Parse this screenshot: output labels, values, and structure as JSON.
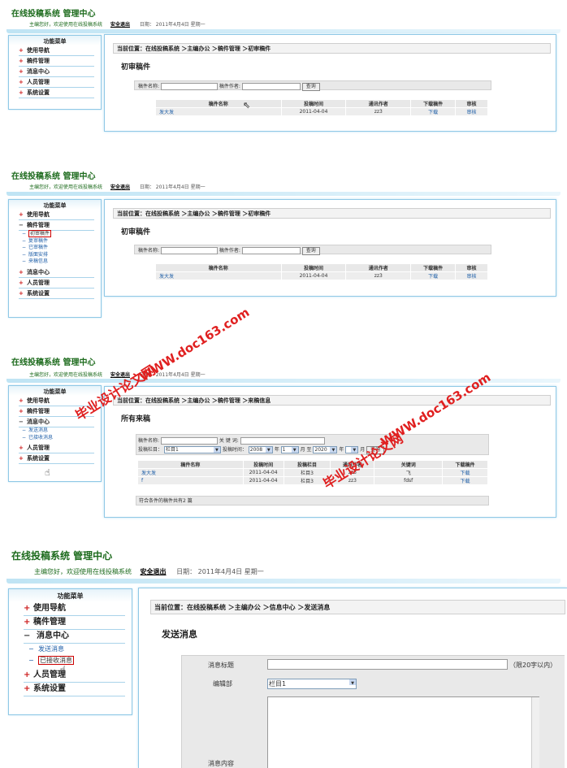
{
  "header": {
    "title": "在线投稿系统 管理中心",
    "welcome": "主编您好，欢迎使用在线投稿系统",
    "logout": "安全退出",
    "date": "日期： 2011年4月4日 星期一"
  },
  "sidebar": {
    "title": "功能菜单",
    "items": [
      "使用导航",
      "稿件管理",
      "消息中心",
      "人员管理",
      "系统设置"
    ],
    "manuscript_sub": [
      "初审稿件",
      "复审稿件",
      "已审稿件",
      "版面安排",
      "来稿信息"
    ],
    "message_sub": [
      "发送消息",
      "已接收消息"
    ]
  },
  "panel1": {
    "crumb": "当前位置：在线投稿系统 ＞主编办公 ＞稿件管理 ＞初审稿件",
    "title": "初审稿件",
    "label_name": "稿件名称:",
    "label_author": "稿件作者:",
    "query": "查询",
    "headers": [
      "稿件名称",
      "投稿时间",
      "通讯作者",
      "下载稿件",
      "审核"
    ],
    "rows": [
      [
        "发大发",
        "2011-04-04",
        "zz3",
        "下载",
        "审核"
      ]
    ]
  },
  "panel3": {
    "crumb": "当前位置：在线投稿系统 ＞主编办公 ＞稿件管理 ＞来稿信息",
    "title": "所有来稿",
    "label_name": "稿件名称:",
    "label_keyword": "关 键 词:",
    "label_column": "投稿栏目：",
    "column_value": "栏目1",
    "label_time": "投稿时间：",
    "year_from": "2008",
    "year_unit": "年",
    "month_from": "1",
    "month_to_label": "月 至",
    "year_to": "2020",
    "month_unit": "月",
    "query": "查询",
    "headers": [
      "稿件名称",
      "投稿时间",
      "投稿栏目",
      "通讯作者",
      "关键词",
      "下载稿件"
    ],
    "rows": [
      [
        "发大发",
        "2011-04-04",
        "栏目3",
        "zz3",
        "飞",
        "下载"
      ],
      [
        "f",
        "2011-04-04",
        "栏目3",
        "zz3",
        "fdsf",
        "下载"
      ]
    ],
    "footer": "符合条件的稿件共有2 篇"
  },
  "panel4": {
    "crumb": "当前位置：在线投稿系统 ＞主编办公 ＞信息中心 ＞发送消息",
    "title": "发送消息",
    "label_subject": "消息标题",
    "subject_hint": "（限20字以内）",
    "label_dept": "编辑部",
    "dept_value": "栏目1",
    "label_content": "消息内容"
  },
  "watermark": {
    "site": "WWW.doc163.com",
    "brand": "毕业设计论文网"
  }
}
